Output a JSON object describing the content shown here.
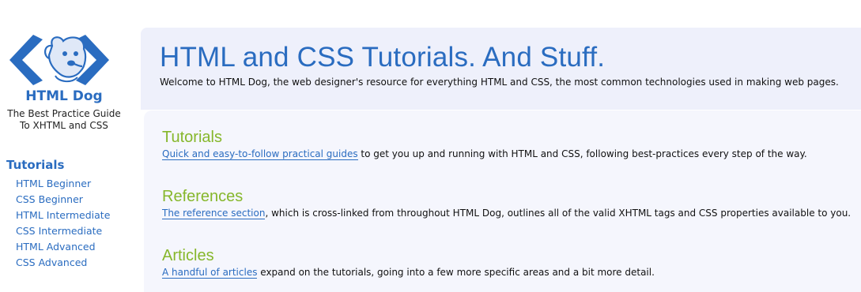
{
  "brand": {
    "name": "HTML Dog",
    "tagline_line1": "The Best Practice Guide",
    "tagline_line2": "To XHTML and CSS",
    "logo_icon": "dog-logo-icon"
  },
  "sidebar": {
    "heading": "Tutorials",
    "items": [
      {
        "label": "HTML Beginner"
      },
      {
        "label": "CSS Beginner"
      },
      {
        "label": "HTML Intermediate"
      },
      {
        "label": "CSS Intermediate"
      },
      {
        "label": "HTML Advanced"
      },
      {
        "label": "CSS Advanced"
      }
    ]
  },
  "header": {
    "title": "HTML and CSS Tutorials. And Stuff.",
    "welcome": "Welcome to HTML Dog, the web designer's resource for everything HTML and CSS, the most common technologies used in making web pages."
  },
  "sections": [
    {
      "heading": "Tutorials",
      "link": "Quick and easy-to-follow practical guides",
      "text": " to get you up and running with HTML and CSS, following best-practices every step of the way."
    },
    {
      "heading": "References",
      "link": "The reference section",
      "text": ", which is cross-linked from throughout HTML Dog, outlines all of the valid XHTML tags and CSS properties available to you."
    },
    {
      "heading": "Articles",
      "link": "A handful of articles",
      "text": " expand on the tutorials, going into a few more specific areas and a bit more detail."
    }
  ],
  "colors": {
    "brand_blue": "#2a6cc0",
    "section_green": "#86b72b",
    "header_bg": "#eef0fb"
  }
}
